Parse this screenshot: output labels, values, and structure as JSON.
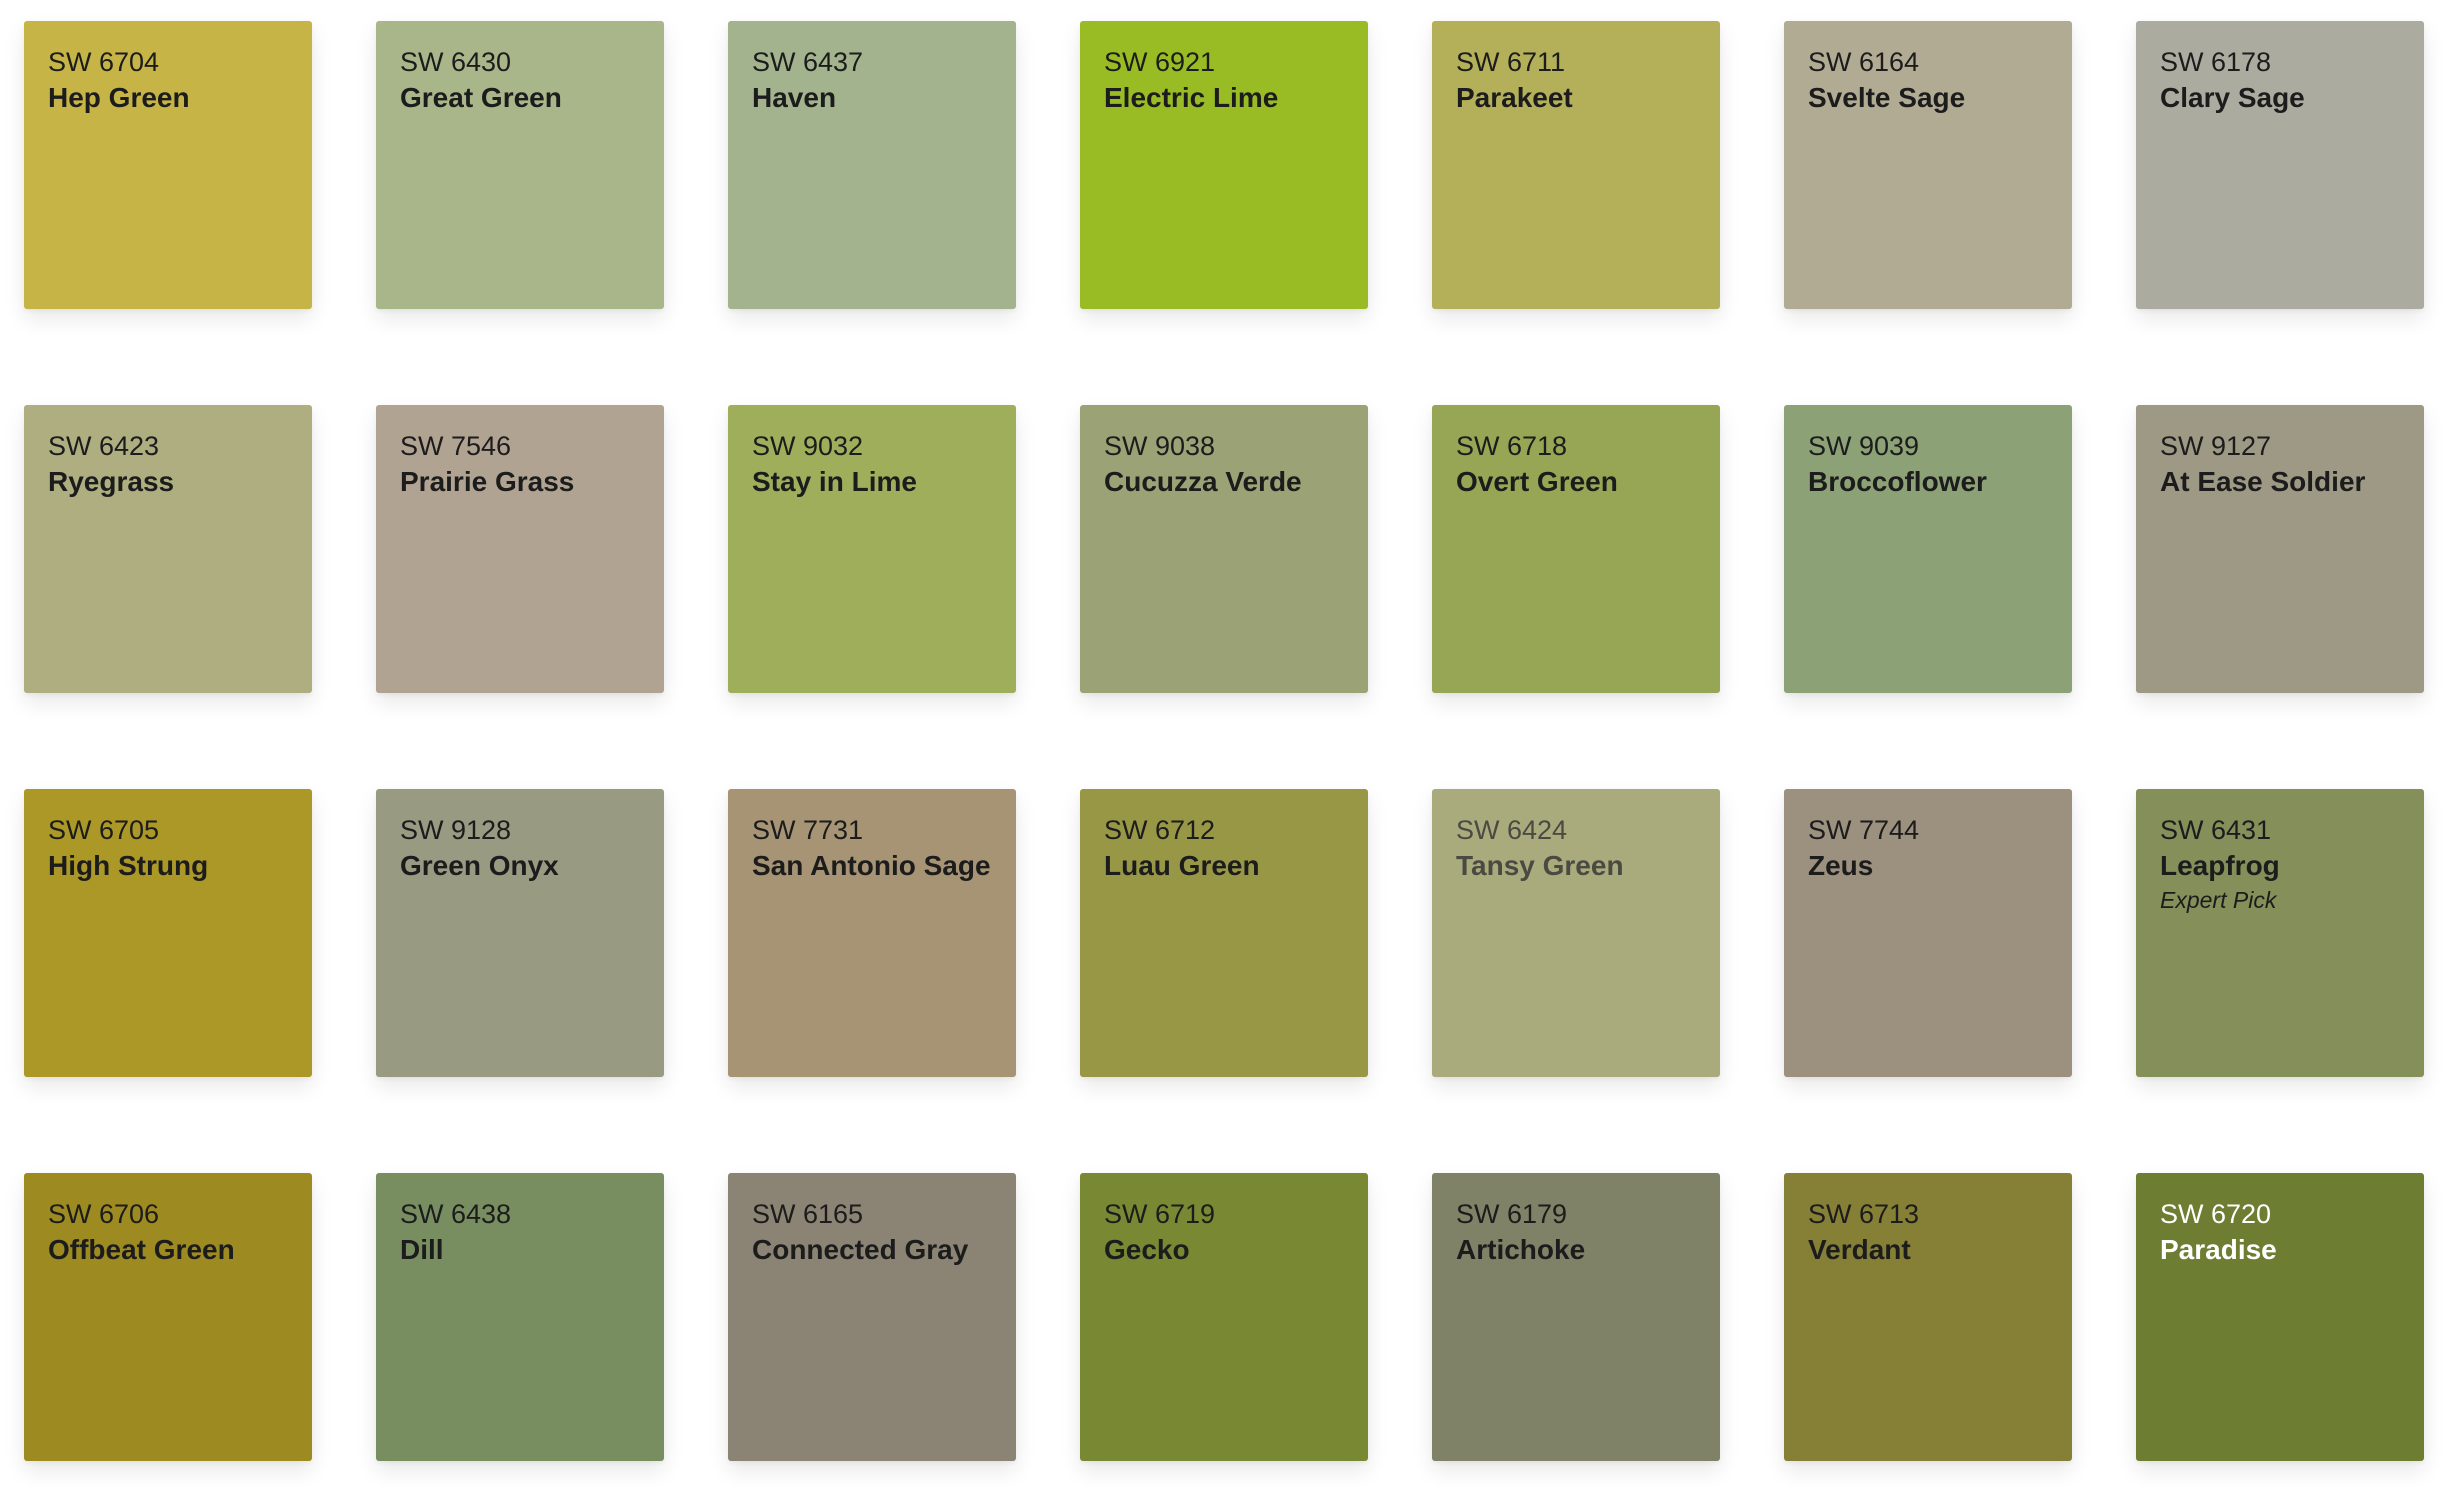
{
  "swatches": [
    {
      "code": "SW 6704",
      "name": "Hep Green",
      "color": "#c6b447",
      "text": "#1c1c1c"
    },
    {
      "code": "SW 6430",
      "name": "Great Green",
      "color": "#a8b689",
      "text": "#1c1c1c"
    },
    {
      "code": "SW 6437",
      "name": "Haven",
      "color": "#a2b38d",
      "text": "#1c1c1c"
    },
    {
      "code": "SW 6921",
      "name": "Electric Lime",
      "color": "#99bb24",
      "text": "#1c1c1c"
    },
    {
      "code": "SW 6711",
      "name": "Parakeet",
      "color": "#b4b05a",
      "text": "#1c1c1c"
    },
    {
      "code": "SW 6164",
      "name": "Svelte Sage",
      "color": "#b2ab94",
      "text": "#1c1c1c"
    },
    {
      "code": "SW 6178",
      "name": "Clary Sage",
      "color": "#ababa0",
      "text": "#1c1c1c"
    },
    {
      "code": "SW 6423",
      "name": "Ryegrass",
      "color": "#aeae80",
      "text": "#1c1c1c"
    },
    {
      "code": "SW 7546",
      "name": "Prairie Grass",
      "color": "#b1a392",
      "text": "#1c1c1c"
    },
    {
      "code": "SW 9032",
      "name": "Stay in Lime",
      "color": "#9fae5b",
      "text": "#1c1c1c"
    },
    {
      "code": "SW 9038",
      "name": "Cucuzza Verde",
      "color": "#9ba376",
      "text": "#1c1c1c"
    },
    {
      "code": "SW 6718",
      "name": "Overt Green",
      "color": "#97a654",
      "text": "#1c1c1c"
    },
    {
      "code": "SW 9039",
      "name": "Broccoflower",
      "color": "#8ca176",
      "text": "#1c1c1c"
    },
    {
      "code": "SW 9127",
      "name": "At Ease Soldier",
      "color": "#9e9985",
      "text": "#1c1c1c"
    },
    {
      "code": "SW 6705",
      "name": "High Strung",
      "color": "#ac9826",
      "text": "#1c1c1c"
    },
    {
      "code": "SW 9128",
      "name": "Green Onyx",
      "color": "#989a82",
      "text": "#1c1c1c"
    },
    {
      "code": "SW 7731",
      "name": "San Antonio Sage",
      "color": "#a69474",
      "text": "#1c1c1c"
    },
    {
      "code": "SW 6712",
      "name": "Luau Green",
      "color": "#989746",
      "text": "#1c1c1c"
    },
    {
      "code": "SW 6424",
      "name": "Tansy Green",
      "color": "#aaab7d",
      "text": "#4a4a42"
    },
    {
      "code": "SW 7744",
      "name": "Zeus",
      "color": "#9b917e",
      "text": "#1c1c1c"
    },
    {
      "code": "SW 6431",
      "name": "Leapfrog",
      "color": "#848f59",
      "text": "#1c1c1c",
      "badge": "Expert Pick"
    },
    {
      "code": "SW 6706",
      "name": "Offbeat Green",
      "color": "#9d8a20",
      "text": "#1c1c1c"
    },
    {
      "code": "SW 6438",
      "name": "Dill",
      "color": "#788e61",
      "text": "#1c1c1c"
    },
    {
      "code": "SW 6165",
      "name": "Connected Gray",
      "color": "#8b8474",
      "text": "#1c1c1c"
    },
    {
      "code": "SW 6719",
      "name": "Gecko",
      "color": "#798833",
      "text": "#1c1c1c"
    },
    {
      "code": "SW 6179",
      "name": "Artichoke",
      "color": "#7f8267",
      "text": "#1c1c1c"
    },
    {
      "code": "SW 6713",
      "name": "Verdant",
      "color": "#867f36",
      "text": "#1c1c1c"
    },
    {
      "code": "SW 6720",
      "name": "Paradise",
      "color": "#6d7d32",
      "text": "#ffffff"
    }
  ]
}
